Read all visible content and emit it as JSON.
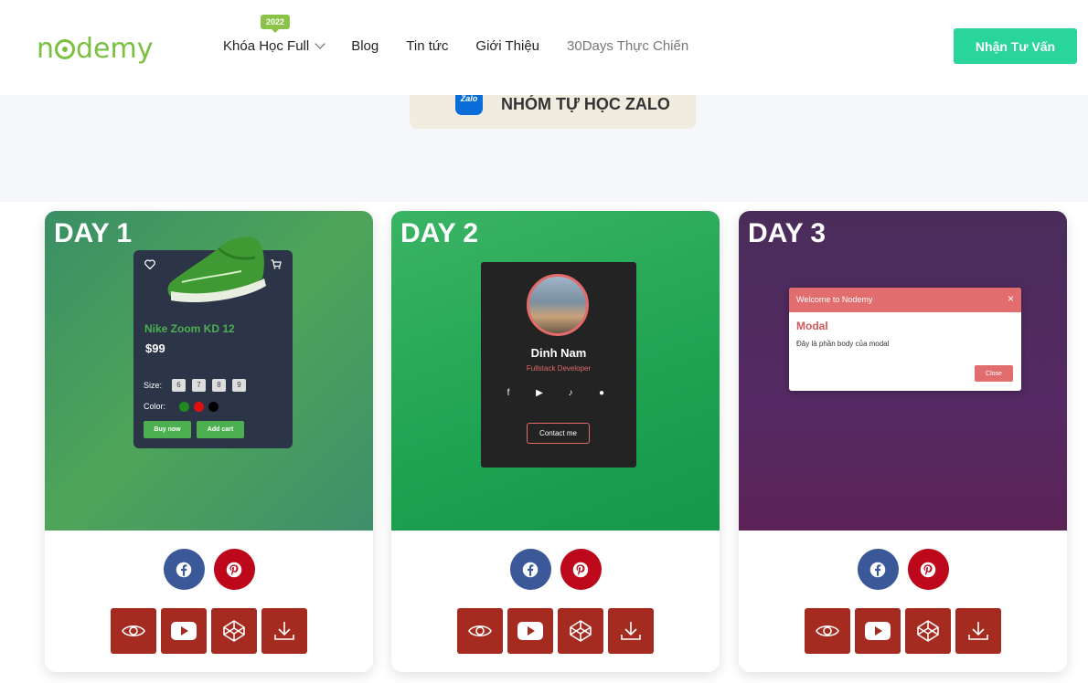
{
  "header": {
    "logo_text_pre": "n",
    "logo_text_post": "demy",
    "nav": [
      {
        "label": "Khóa Học Full",
        "badge": "2022"
      },
      {
        "label": "Blog"
      },
      {
        "label": "Tin tức"
      },
      {
        "label": "Giới Thiệu"
      },
      {
        "label": "30Days Thực Chiến"
      }
    ],
    "cta_label": "Nhận Tư Vấn"
  },
  "zalo": {
    "icon_text": "Zalo",
    "label": "NHÓM TỰ HỌC ZALO"
  },
  "cards": [
    {
      "title": "DAY 1",
      "product": {
        "name": "Nike Zoom KD 12",
        "price": "$99",
        "size_label": "Size:",
        "sizes": [
          "6",
          "7",
          "8",
          "9"
        ],
        "color_label": "Color:",
        "colors": [
          "#1f8a1f",
          "#e01010",
          "#000000"
        ],
        "buy_label": "Buy now",
        "cart_label": "Add cart"
      }
    },
    {
      "title": "DAY 2",
      "profile": {
        "name": "Dinh Nam",
        "role": "Fullstack Developer",
        "contact_label": "Contact me"
      }
    },
    {
      "title": "DAY 3",
      "modal": {
        "header": "Welcome to Nodemy",
        "close_x": "×",
        "title": "Modal",
        "body": "Đây là phần body của modal",
        "close_label": "Close"
      }
    }
  ],
  "colors": {
    "brand": "#7ac142",
    "cta": "#2ad59b",
    "facebook": "#3b5998",
    "pinterest": "#bd081c",
    "action": "#a52a1f"
  },
  "icons": {
    "share": [
      "facebook-icon",
      "pinterest-icon"
    ],
    "actions": [
      "eye-icon",
      "youtube-icon",
      "codepen-icon",
      "download-icon"
    ]
  }
}
